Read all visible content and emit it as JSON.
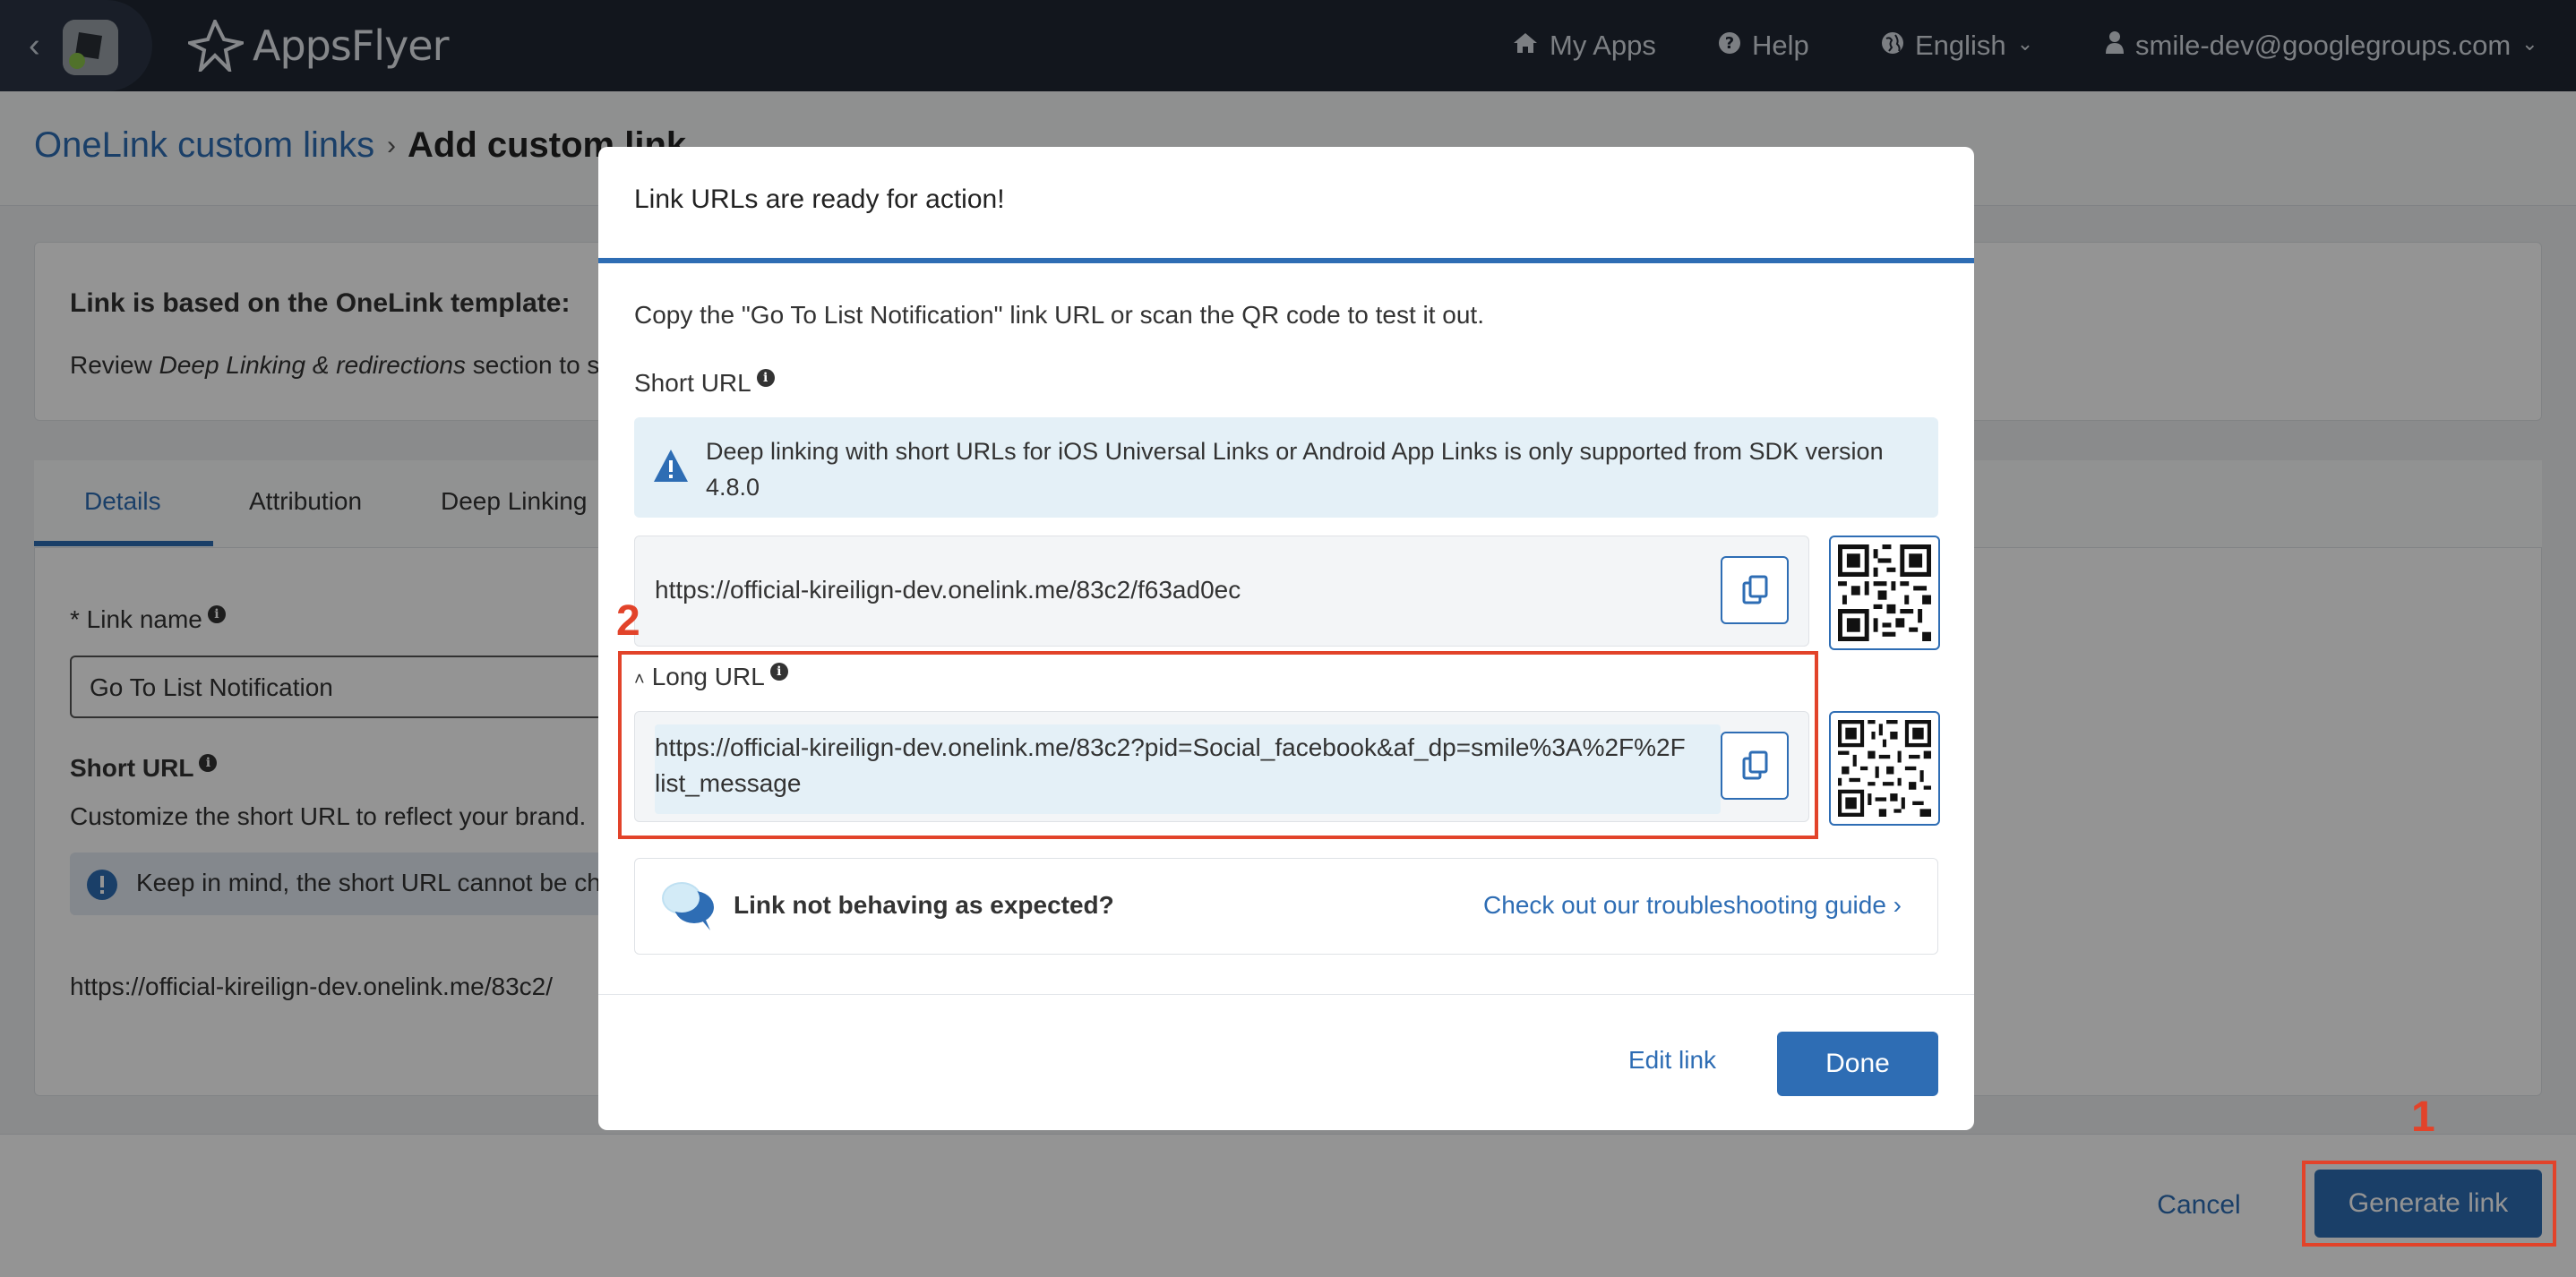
{
  "topbar": {
    "brand": "AppsFlyer",
    "nav": [
      {
        "label": "My Apps",
        "icon": "home-icon"
      },
      {
        "label": "Help",
        "icon": "question-icon"
      },
      {
        "label": "English",
        "icon": "globe-icon"
      },
      {
        "label": "smile-dev@googlegroups.com",
        "icon": "user-icon"
      }
    ]
  },
  "breadcrumb": {
    "parent": "OneLink custom links",
    "current": "Add custom link"
  },
  "template_card": {
    "title": "Link is based on the OneLink template:",
    "review_prefix": "Review ",
    "review_italic": "Deep Linking & redirections",
    "review_suffix": " section to s"
  },
  "tabs": [
    "Details",
    "Attribution",
    "Deep Linking"
  ],
  "details": {
    "link_name_label": "* Link name",
    "link_name_value": "Go To List Notification",
    "short_url_label": "Short URL",
    "short_url_help": "Customize the short URL to reflect your brand.",
    "warning": "Keep in mind, the short URL cannot be ch",
    "short_url_prefix": "https://official-kireilign-dev.onelink.me/83c2/"
  },
  "footer": {
    "cancel": "Cancel",
    "generate": "Generate link"
  },
  "annotations": {
    "one": "1",
    "two": "2"
  },
  "modal": {
    "title": "Link URLs are ready for action!",
    "intro": "Copy the \"Go To List Notification\" link URL or scan the QR code to test it out.",
    "short_url_label": "Short URL",
    "info": "Deep linking with short URLs for iOS Universal Links or Android App Links is only supported from SDK version 4.8.0",
    "short_url": "https://official-kireilign-dev.onelink.me/83c2/f63ad0ec",
    "long_url_label": "Long URL",
    "long_url_line1": "https://official-kireilign-dev.onelink.me/83c2?pid=Social_facebook&af_dp=smile%3A%2F%2F",
    "long_url_line2": "list_message",
    "trouble_title": "Link not behaving as expected?",
    "trouble_link": "Check out our troubleshooting guide ›",
    "edit": "Edit link",
    "done": "Done"
  },
  "colors": {
    "accent": "#2e6db4",
    "topbar": "#1f2733",
    "annotation_red": "#e2432a",
    "info_bg": "#e4f0f7"
  }
}
